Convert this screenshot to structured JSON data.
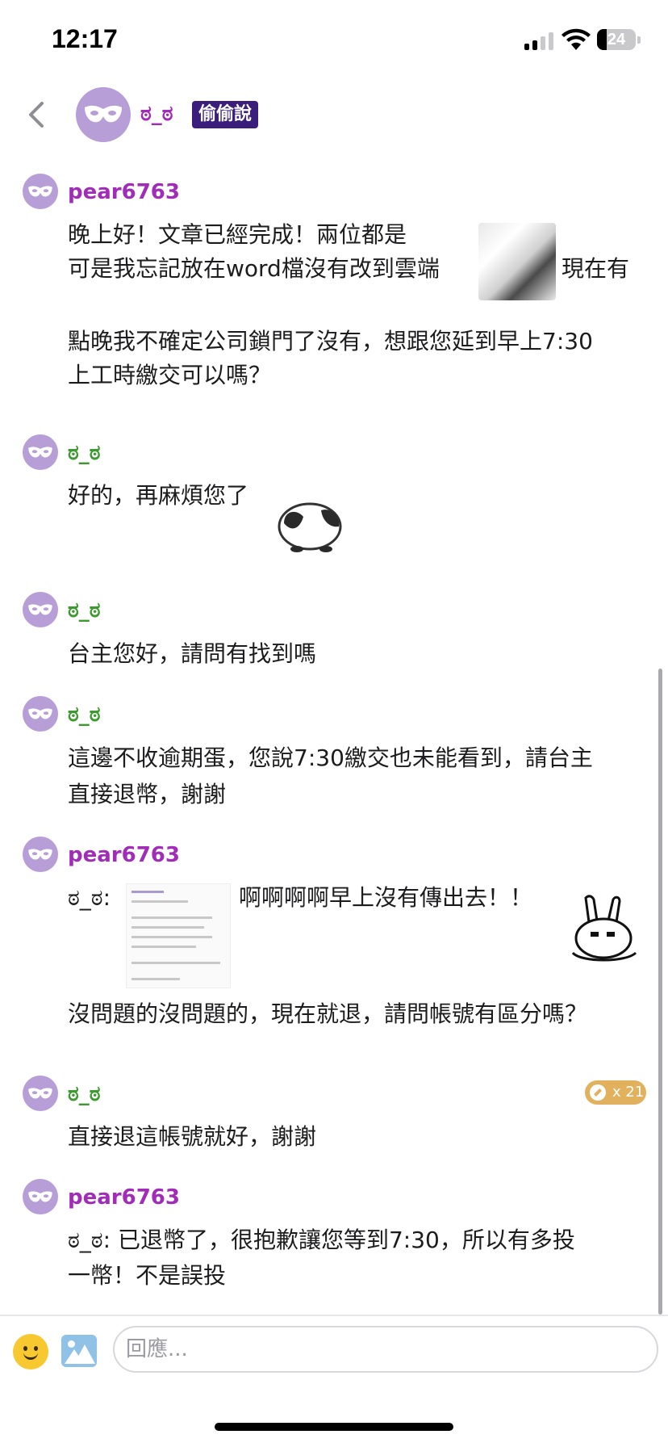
{
  "status_bar": {
    "time": "12:17",
    "battery": "24",
    "battery_level": 0.24
  },
  "header": {
    "name": "ಠ_ಠ",
    "badge": "偷偷說"
  },
  "messages": [
    {
      "author": "pear6763",
      "lines": [
        "晚上好！文章已經完成！兩位都是",
        "可是我忘記放在word檔沒有改到雲端",
        "現在有",
        "點晚我不確定公司鎖門了沒有，想跟您延到早上7:30",
        "上工時繳交可以嗎？"
      ]
    },
    {
      "author": "ಠ_ಠ",
      "lines": [
        "好的，再麻煩您了"
      ]
    },
    {
      "author": "ಠ_ಠ",
      "lines": [
        "台主您好，請問有找到嗎"
      ]
    },
    {
      "author": "ಠ_ಠ",
      "lines": [
        "這邊不收逾期蛋，您說7:30繳交也未能看到，請台主",
        "直接退幣，謝謝"
      ]
    },
    {
      "author": "pear6763",
      "lines": [
        "ಠ_ಠ:",
        "啊啊啊啊早上沒有傳出去！！",
        "沒問題的沒問題的，現在就退，請問帳號有區分嗎？"
      ]
    },
    {
      "author": "ಠ_ಠ",
      "lines": [
        "直接退這帳號就好，謝謝"
      ],
      "coin_count": "x 21"
    },
    {
      "author": "pear6763",
      "lines": [
        "ಠ_ಠ: 已退幣了，很抱歉讓您等到7:30，所以有多投",
        "一幣！不是誤投"
      ]
    }
  ],
  "input": {
    "placeholder": "回應..."
  },
  "icons": {
    "back": "back-chevron-icon",
    "avatar": "masquerade-mask-icon",
    "emoji": "smiley-face-icon",
    "image": "image-upload-icon",
    "coin": "coin-icon"
  },
  "colors": {
    "author_purple": "#a02cb8",
    "author_green": "#3d9a2e",
    "badge_bg": "#3b1e7c",
    "avatar_bg": "#b79ed6",
    "coin_badge": "#e2b15d"
  }
}
